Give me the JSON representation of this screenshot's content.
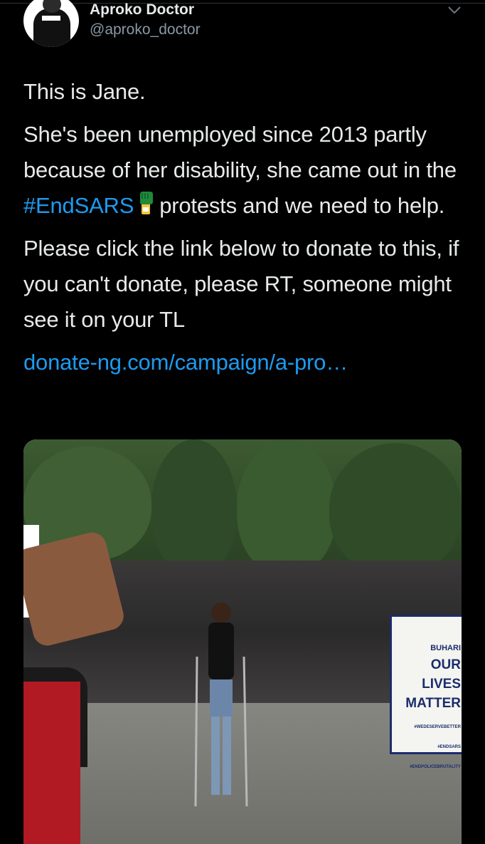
{
  "author": {
    "name": "Aproko Doctor",
    "handle": "@aproko_doctor"
  },
  "icons": {
    "menu": "chevron-down-icon",
    "avatar": "profile-avatar",
    "emoji": "raised-fist-icon"
  },
  "tweet": {
    "p1": "This is Jane.",
    "p2_a": "She's been unemployed since 2013 partly because of her disability, she came out in the ",
    "p2_hashtag": "#EndSARS",
    "p2_b": "protests and we need to help.",
    "p3": "Please click the link below to donate to this, if you can't donate, please RT, someone might see it on your TL",
    "link": "donate-ng.com/campaign/a-pro…"
  },
  "media": {
    "sign_line1": "BUHARI",
    "sign_line2": "OUR",
    "sign_line3": "LIVES",
    "sign_line4": "MATTER",
    "sign_small1": "#WEDESERVEBETTER",
    "sign_small2": "#ENDSARS",
    "sign_small3": "#ENDPOLICEBRUTALITY"
  },
  "colors": {
    "background": "#000000",
    "text": "#e7e9ea",
    "secondary": "#8b98a5",
    "link": "#1d9bf0"
  }
}
